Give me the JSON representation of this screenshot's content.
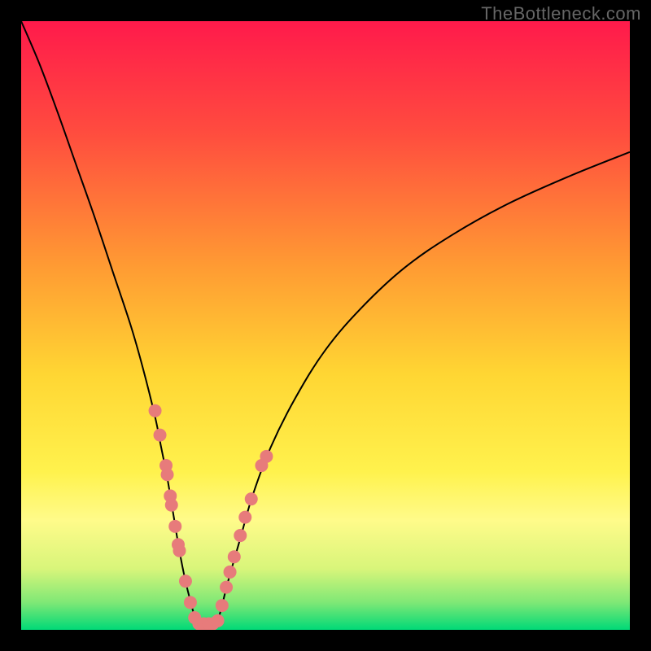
{
  "watermark": "TheBottleneck.com",
  "chart_data": {
    "type": "line",
    "title": "",
    "xlabel": "",
    "ylabel": "",
    "xlim": [
      0,
      100
    ],
    "ylim": [
      0,
      100
    ],
    "grid": false,
    "legend": false,
    "background_gradient": {
      "stops": [
        {
          "offset": 0.0,
          "color": "#ff1a4b"
        },
        {
          "offset": 0.18,
          "color": "#ff4b3f"
        },
        {
          "offset": 0.4,
          "color": "#ff9a33"
        },
        {
          "offset": 0.58,
          "color": "#ffd633"
        },
        {
          "offset": 0.74,
          "color": "#fff24d"
        },
        {
          "offset": 0.82,
          "color": "#fffb8a"
        },
        {
          "offset": 0.9,
          "color": "#d8f57a"
        },
        {
          "offset": 0.955,
          "color": "#7fe876"
        },
        {
          "offset": 1.0,
          "color": "#00d977"
        }
      ]
    },
    "series": [
      {
        "name": "left-branch",
        "stroke": "#000000",
        "x": [
          0,
          3,
          6,
          9,
          12,
          15,
          18,
          20,
          22,
          23,
          24,
          25,
          26,
          27,
          28,
          28.8
        ],
        "y": [
          100,
          93,
          85,
          76.5,
          68,
          59,
          50,
          43,
          35,
          30,
          25,
          19,
          13,
          8,
          4,
          1
        ]
      },
      {
        "name": "right-branch",
        "stroke": "#000000",
        "x": [
          32.2,
          33,
          34,
          36,
          38,
          41,
          45,
          50,
          56,
          63,
          71,
          80,
          90,
          100
        ],
        "y": [
          1,
          4,
          8,
          15,
          22,
          30,
          38,
          46,
          53,
          59.5,
          65,
          70,
          74.5,
          78.5
        ]
      }
    ],
    "flat_bottom": {
      "x1": 28.8,
      "x2": 32.2,
      "y": 1
    },
    "scatter": {
      "color": "#e77b7b",
      "radius": 8,
      "points": [
        {
          "x": 22.0,
          "y": 36.0
        },
        {
          "x": 22.8,
          "y": 32.0
        },
        {
          "x": 23.8,
          "y": 27.0
        },
        {
          "x": 24.0,
          "y": 25.5
        },
        {
          "x": 24.5,
          "y": 22.0
        },
        {
          "x": 24.7,
          "y": 20.5
        },
        {
          "x": 25.3,
          "y": 17.0
        },
        {
          "x": 25.8,
          "y": 14.0
        },
        {
          "x": 26.0,
          "y": 13.0
        },
        {
          "x": 27.0,
          "y": 8.0
        },
        {
          "x": 27.8,
          "y": 4.5
        },
        {
          "x": 28.5,
          "y": 2.0
        },
        {
          "x": 29.2,
          "y": 1.0
        },
        {
          "x": 30.0,
          "y": 1.0
        },
        {
          "x": 30.8,
          "y": 1.0
        },
        {
          "x": 31.5,
          "y": 1.0
        },
        {
          "x": 32.3,
          "y": 1.5
        },
        {
          "x": 33.0,
          "y": 4.0
        },
        {
          "x": 33.7,
          "y": 7.0
        },
        {
          "x": 34.3,
          "y": 9.5
        },
        {
          "x": 35.0,
          "y": 12.0
        },
        {
          "x": 36.0,
          "y": 15.5
        },
        {
          "x": 36.8,
          "y": 18.5
        },
        {
          "x": 37.8,
          "y": 21.5
        },
        {
          "x": 39.5,
          "y": 27.0
        },
        {
          "x": 40.3,
          "y": 28.5
        }
      ]
    }
  }
}
